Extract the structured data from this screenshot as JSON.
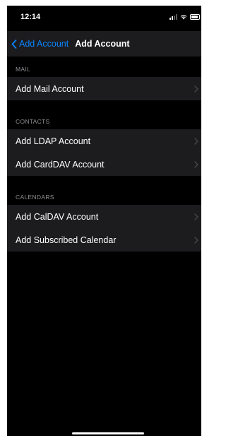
{
  "status_bar": {
    "time": "12:14"
  },
  "nav": {
    "back_label": "Add Account",
    "title": "Add Account"
  },
  "sections": [
    {
      "header": "MAIL",
      "items": [
        {
          "label": "Add Mail Account"
        }
      ]
    },
    {
      "header": "CONTACTS",
      "items": [
        {
          "label": "Add LDAP Account"
        },
        {
          "label": "Add CardDAV Account"
        }
      ]
    },
    {
      "header": "CALENDARS",
      "items": [
        {
          "label": "Add CalDAV Account"
        },
        {
          "label": "Add Subscribed Calendar"
        }
      ]
    }
  ],
  "colors": {
    "background": "#000000",
    "cell": "#1c1c1e",
    "accent": "#0a84ff",
    "secondary_text": "#8e8e93"
  },
  "icons": {
    "back": "chevron-left-icon",
    "row": "chevron-right-icon",
    "signal": "cellular-signal-icon",
    "wifi": "wifi-icon",
    "battery": "battery-icon"
  }
}
